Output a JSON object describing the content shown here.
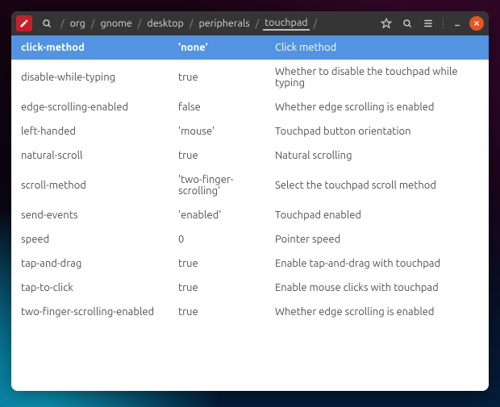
{
  "breadcrumb": {
    "segments": [
      "org",
      "gnome",
      "desktop",
      "peripherals",
      "touchpad"
    ]
  },
  "settings": [
    {
      "key": "click-method",
      "value": "'none'",
      "desc": "Click method",
      "selected": true
    },
    {
      "key": "disable-while-typing",
      "value": "true",
      "desc": "Whether to disable the touchpad while typing"
    },
    {
      "key": "edge-scrolling-enabled",
      "value": "false",
      "desc": "Whether edge scrolling is enabled"
    },
    {
      "key": "left-handed",
      "value": "'mouse'",
      "desc": "Touchpad button orientation"
    },
    {
      "key": "natural-scroll",
      "value": "true",
      "desc": "Natural scrolling"
    },
    {
      "key": "scroll-method",
      "value": "'two-finger-scrolling'",
      "desc": "Select the touchpad scroll method"
    },
    {
      "key": "send-events",
      "value": "'enabled'",
      "desc": "Touchpad enabled"
    },
    {
      "key": "speed",
      "value": "0",
      "desc": "Pointer speed"
    },
    {
      "key": "tap-and-drag",
      "value": "true",
      "desc": "Enable tap-and-drag with touchpad"
    },
    {
      "key": "tap-to-click",
      "value": "true",
      "desc": "Enable mouse clicks with touchpad"
    },
    {
      "key": "two-finger-scrolling-enabled",
      "value": "true",
      "desc": "Whether edge scrolling is enabled"
    }
  ]
}
